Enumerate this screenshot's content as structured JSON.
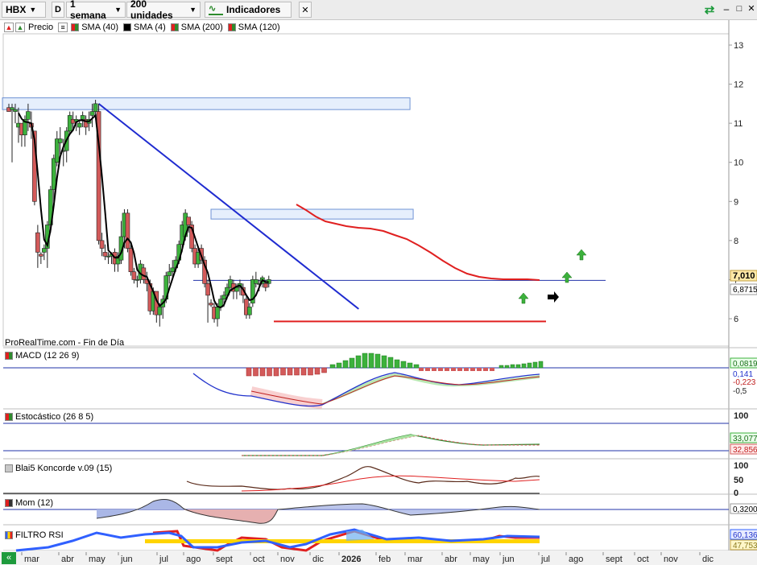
{
  "toolbar": {
    "ticker": "HBX",
    "period_icon": "D",
    "timeframe": "1 semana",
    "units": "200 unidades",
    "indicators": "Indicadores"
  },
  "indicator_row": {
    "price": "Precio",
    "sma": [
      {
        "label": "SMA (40)",
        "color": "#2e8b2e"
      },
      {
        "label": "SMA (4)",
        "color": "#000000"
      },
      {
        "label": "SMA (200)",
        "color": "#2e8b2e"
      },
      {
        "label": "SMA (120)",
        "color": "#e02020"
      }
    ]
  },
  "credit": "ProRealTime.com - Fin de Día",
  "price_axis": {
    "ticks": [
      "13",
      "12",
      "11",
      "10",
      "9",
      "8",
      "7",
      "6"
    ],
    "last_price": "7,010",
    "second_price": "6,8715"
  },
  "panels": [
    {
      "label": "MACD (12 26 9)",
      "values": [
        "0,0819",
        "0,141",
        "-0,223"
      ],
      "ticks": [
        "-0,5"
      ]
    },
    {
      "label": "Estocástico (26 8 5)",
      "values": [
        "33,077",
        "32,856"
      ],
      "ticks": [
        "100"
      ]
    },
    {
      "label": "Blai5 Koncorde v.09 (15)",
      "values": [],
      "ticks": [
        "100",
        "50",
        "0"
      ]
    },
    {
      "label": "Mom (12)",
      "values": [
        "0,3200"
      ],
      "ticks": []
    },
    {
      "label": "FILTRO RSI",
      "values": [
        "60,136",
        "47,753"
      ],
      "ticks": []
    }
  ],
  "x_axis": {
    "labels": [
      "mar",
      "abr",
      "may",
      "jun",
      "jul",
      "ago",
      "sept",
      "oct",
      "nov",
      "dic",
      "2026",
      "feb",
      "mar",
      "abr",
      "may",
      "jun",
      "jul",
      "ago",
      "sept",
      "oct",
      "nov",
      "dic"
    ]
  },
  "chart_data": {
    "type": "candlestick",
    "timeframe": "1 semana",
    "ylim": [
      5.6,
      13.4
    ],
    "candles": [
      [
        11.4,
        11.3,
        11.5,
        11.3
      ],
      [
        11.35,
        11.4,
        11.5,
        10.0
      ],
      [
        11.3,
        11.35,
        11.5,
        11.0
      ],
      [
        10.9,
        11.0,
        11.4,
        10.5
      ],
      [
        11.0,
        10.7,
        11.0,
        10.4
      ],
      [
        10.7,
        11.1,
        11.2,
        10.4
      ],
      [
        11.1,
        11.3,
        11.5,
        10.8
      ],
      [
        11.0,
        10.9,
        11.3,
        10.6
      ],
      [
        10.8,
        9.0,
        10.8,
        8.9
      ],
      [
        8.2,
        7.7,
        8.4,
        7.3
      ],
      [
        7.65,
        7.6,
        7.7,
        7.4
      ],
      [
        7.7,
        7.8,
        7.9,
        7.5
      ],
      [
        7.8,
        8.4,
        8.5,
        7.3
      ],
      [
        8.4,
        9.3,
        9.4,
        8.2
      ],
      [
        9.3,
        10.1,
        10.2,
        9.0
      ],
      [
        10.0,
        10.6,
        10.8,
        9.9
      ],
      [
        10.5,
        10.6,
        10.9,
        10.2
      ],
      [
        10.3,
        10.3,
        10.6,
        9.9
      ],
      [
        10.3,
        10.8,
        10.9,
        10.0
      ],
      [
        10.8,
        11.2,
        11.3,
        10.7
      ],
      [
        11.1,
        11.0,
        11.3,
        10.8
      ],
      [
        11.05,
        11.1,
        11.2,
        10.8
      ],
      [
        10.9,
        11.0,
        11.1,
        10.7
      ],
      [
        11.1,
        11.2,
        11.3,
        10.9
      ],
      [
        11.1,
        10.9,
        11.2,
        10.7
      ],
      [
        11.0,
        11.1,
        11.3,
        10.8
      ],
      [
        11.2,
        11.3,
        11.5,
        10.9
      ],
      [
        11.3,
        11.5,
        11.6,
        11.2
      ],
      [
        11.3,
        8.0,
        11.5,
        7.9
      ],
      [
        8.0,
        7.8,
        8.2,
        7.6
      ],
      [
        7.7,
        7.6,
        7.9,
        7.5
      ],
      [
        7.6,
        7.6,
        7.7,
        7.4
      ],
      [
        7.6,
        7.65,
        7.7,
        7.4
      ],
      [
        7.7,
        7.4,
        7.8,
        7.2
      ],
      [
        7.4,
        7.6,
        7.7,
        7.2
      ],
      [
        7.5,
        8.1,
        8.5,
        7.4
      ],
      [
        8.1,
        8.7,
        8.8,
        7.8
      ],
      [
        8.7,
        7.8,
        8.8,
        7.7
      ],
      [
        7.8,
        7.2,
        7.9,
        7.1
      ],
      [
        7.2,
        7.0,
        7.3,
        6.9
      ],
      [
        7.0,
        7.0,
        7.1,
        6.8
      ],
      [
        7.0,
        7.4,
        7.5,
        6.9
      ],
      [
        7.3,
        7.0,
        7.4,
        6.9
      ],
      [
        7.0,
        6.9,
        7.2,
        6.7
      ],
      [
        6.9,
        6.2,
        7.0,
        6.1
      ],
      [
        6.2,
        6.7,
        6.8,
        6.1
      ],
      [
        6.7,
        6.1,
        6.7,
        5.9
      ],
      [
        6.1,
        6.3,
        6.4,
        5.8
      ],
      [
        6.3,
        6.5,
        6.6,
        6.0
      ],
      [
        6.5,
        7.1,
        7.2,
        6.4
      ],
      [
        7.1,
        7.2,
        7.4,
        6.9
      ],
      [
        7.2,
        7.3,
        7.5,
        7.0
      ],
      [
        7.3,
        7.5,
        7.6,
        7.2
      ],
      [
        7.5,
        7.9,
        8.0,
        7.4
      ],
      [
        7.9,
        8.4,
        8.5,
        7.7
      ],
      [
        8.1,
        8.7,
        8.8,
        8.0
      ],
      [
        8.6,
        8.4,
        8.6,
        8.2
      ],
      [
        8.4,
        7.8,
        8.5,
        7.7
      ],
      [
        7.8,
        7.4,
        7.9,
        7.3
      ],
      [
        7.4,
        7.7,
        7.8,
        7.3
      ],
      [
        7.8,
        7.5,
        7.9,
        7.4
      ],
      [
        7.5,
        6.9,
        7.6,
        6.8
      ],
      [
        6.9,
        6.6,
        7.0,
        5.9
      ],
      [
        6.4,
        6.35,
        6.5,
        6.3
      ],
      [
        6.3,
        6.0,
        6.4,
        5.9
      ],
      [
        6.0,
        6.3,
        6.4,
        5.8
      ],
      [
        6.3,
        6.5,
        6.6,
        6.2
      ],
      [
        6.5,
        6.6,
        6.7,
        6.3
      ],
      [
        6.6,
        6.8,
        6.9,
        6.5
      ],
      [
        6.8,
        7.0,
        7.1,
        6.7
      ],
      [
        6.9,
        6.7,
        7.0,
        6.5
      ],
      [
        6.7,
        6.8,
        6.9,
        6.5
      ],
      [
        6.8,
        6.9,
        7.0,
        6.6
      ],
      [
        6.8,
        6.6,
        6.9,
        6.4
      ],
      [
        6.5,
        6.1,
        6.6,
        6.0
      ],
      [
        6.1,
        6.3,
        6.4,
        6.0
      ],
      [
        6.4,
        7.0,
        7.1,
        6.3
      ],
      [
        6.9,
        7.0,
        7.2,
        6.8
      ],
      [
        6.9,
        6.9,
        7.0,
        6.7
      ],
      [
        6.9,
        7.05,
        7.1,
        6.8
      ],
      [
        6.9,
        6.8,
        7.0,
        6.7
      ],
      [
        6.9,
        7.0,
        7.1,
        6.8
      ]
    ],
    "annotations": [
      {
        "type": "zone",
        "from_week": 0,
        "to_week": 127,
        "ylow": 11.35,
        "yhigh": 11.65
      },
      {
        "type": "zone",
        "from_week": 65,
        "to_week": 128,
        "ylow": 8.55,
        "yhigh": 8.8
      },
      {
        "type": "support_line",
        "y": 5.93
      },
      {
        "type": "horizontal_line",
        "y": 6.98
      },
      {
        "type": "trendline",
        "from": [
          28,
          11.5
        ],
        "to": [
          109,
          6.25
        ]
      }
    ]
  }
}
